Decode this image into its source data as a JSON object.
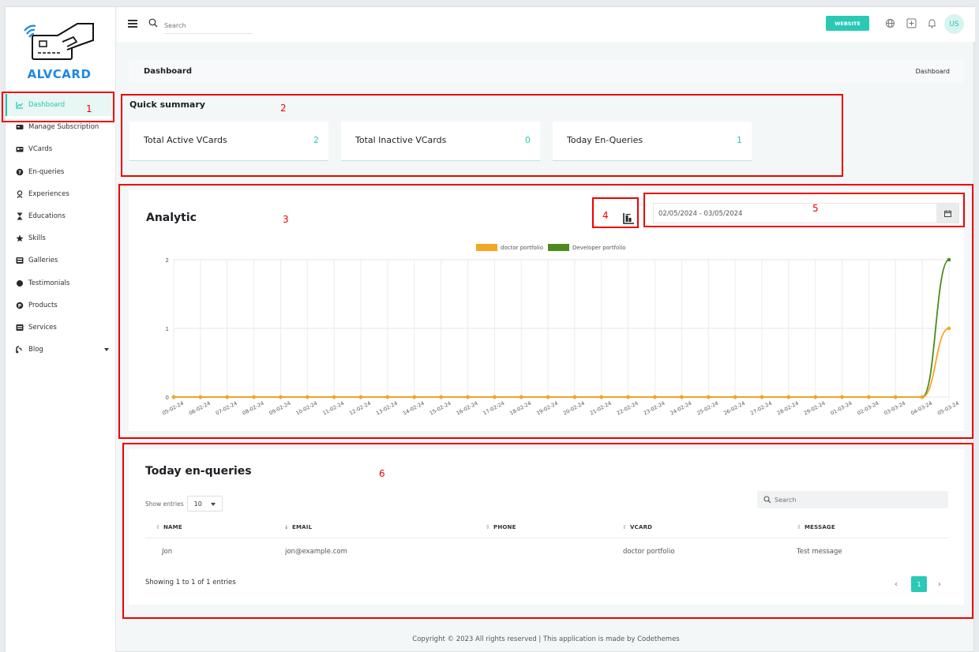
{
  "brand": {
    "name": "ALVCARD"
  },
  "sidebar": {
    "items": [
      {
        "label": "Dashboard",
        "icon": "chart-line-icon",
        "active": true
      },
      {
        "label": "Manage Subscription",
        "icon": "subscription-icon"
      },
      {
        "label": "VCards",
        "icon": "vcard-icon"
      },
      {
        "label": "En-queries",
        "icon": "question-icon"
      },
      {
        "label": "Experiences",
        "icon": "experience-icon"
      },
      {
        "label": "Educations",
        "icon": "hourglass-icon"
      },
      {
        "label": "Skills",
        "icon": "star-icon"
      },
      {
        "label": "Galleries",
        "icon": "gallery-icon"
      },
      {
        "label": "Testimonials",
        "icon": "testimonial-icon"
      },
      {
        "label": "Products",
        "icon": "product-icon"
      },
      {
        "label": "Services",
        "icon": "services-icon"
      },
      {
        "label": "Blog",
        "icon": "blog-icon"
      }
    ]
  },
  "topbar": {
    "search_placeholder": "Search",
    "website_label": "WEBSITE",
    "avatar_initials": "US"
  },
  "breadcrumb": {
    "title": "Dashboard",
    "crumb": "Dashboard"
  },
  "summary": {
    "title": "Quick summary",
    "cards": [
      {
        "label": "Total Active VCards",
        "value": "2"
      },
      {
        "label": "Total Inactive VCards",
        "value": "0"
      },
      {
        "label": "Today En-Queries",
        "value": "1"
      }
    ]
  },
  "analytic": {
    "title": "Analytic",
    "date_range": "02/05/2024 - 03/05/2024"
  },
  "chart_data": {
    "type": "line",
    "x": [
      "05-02-24",
      "06-02-24",
      "07-02-24",
      "08-02-24",
      "09-02-24",
      "10-02-24",
      "11-02-24",
      "12-02-24",
      "13-02-24",
      "14-02-24",
      "15-02-24",
      "16-02-24",
      "17-02-24",
      "18-02-24",
      "19-02-24",
      "20-02-24",
      "21-02-24",
      "22-02-24",
      "23-02-24",
      "24-02-24",
      "25-02-24",
      "26-02-24",
      "27-02-24",
      "28-02-24",
      "29-02-24",
      "01-03-24",
      "02-03-24",
      "03-03-24",
      "04-03-24",
      "05-03-24"
    ],
    "series": [
      {
        "name": "doctor portfolio",
        "color": "#f5a623",
        "values": [
          0,
          0,
          0,
          0,
          0,
          0,
          0,
          0,
          0,
          0,
          0,
          0,
          0,
          0,
          0,
          0,
          0,
          0,
          0,
          0,
          0,
          0,
          0,
          0,
          0,
          0,
          0,
          0,
          0,
          1
        ]
      },
      {
        "name": "Developer portfolio",
        "color": "#4d8a1e",
        "values": [
          0,
          0,
          0,
          0,
          0,
          0,
          0,
          0,
          0,
          0,
          0,
          0,
          0,
          0,
          0,
          0,
          0,
          0,
          0,
          0,
          0,
          0,
          0,
          0,
          0,
          0,
          0,
          0,
          0,
          2
        ]
      }
    ],
    "ylim": [
      0,
      2
    ],
    "yticks": [
      "0",
      "1",
      "2"
    ],
    "grid": true,
    "legend": "top-center"
  },
  "enquiries": {
    "title": "Today en-queries",
    "show_entries_label": "Show entries",
    "entries_value": "10",
    "search_placeholder": "Search",
    "columns": [
      "NAME",
      "EMAIL",
      "PHONE",
      "VCARD",
      "MESSAGE"
    ],
    "rows": [
      {
        "name": "Jon",
        "email": "jon@example.com",
        "phone": "",
        "vcard": "doctor portfolio",
        "message": "Test message"
      }
    ],
    "info": "Showing 1 to 1 of 1 entries",
    "current_page": "1"
  },
  "footer": {
    "text": "Copyright © 2023 All rights reserved | This application is made by Codethemes"
  },
  "annotations": [
    "1",
    "2",
    "3",
    "4",
    "5",
    "6"
  ]
}
